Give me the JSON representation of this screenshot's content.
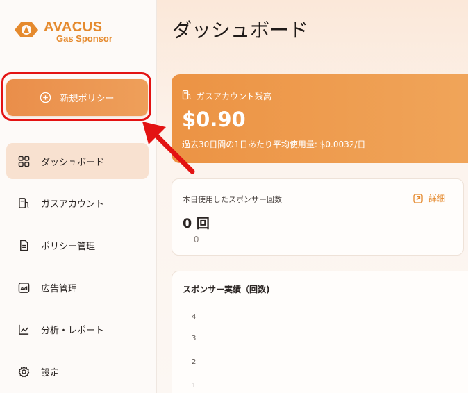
{
  "logo": {
    "title": "AVACUS",
    "subtitle": "Gas Sponsor"
  },
  "sidebar": {
    "new_policy_label": "新規ポリシー",
    "items": [
      {
        "label": "ダッシュボード",
        "icon": "grid-icon"
      },
      {
        "label": "ガスアカウント",
        "icon": "gas-pump-icon"
      },
      {
        "label": "ポリシー管理",
        "icon": "document-icon"
      },
      {
        "label": "広告管理",
        "icon": "ad-icon"
      },
      {
        "label": "分析・レポート",
        "icon": "chart-icon"
      },
      {
        "label": "設定",
        "icon": "gear-icon"
      }
    ]
  },
  "main": {
    "title": "ダッシュボード",
    "balance": {
      "label": "ガスアカウント残高",
      "value": "$0.90",
      "note": "過去30日間の1日あたり平均使用量: $0.0032/日"
    },
    "today": {
      "label": "本日使用したスポンサー回数",
      "detail_label": "詳細",
      "value": "0 回",
      "delta": "— 0"
    },
    "performance": {
      "title": "スポンサー実績（回数)",
      "y_ticks": [
        "4",
        "3",
        "2",
        "1"
      ]
    }
  },
  "colors": {
    "accent": "#e58a2e",
    "highlight": "#e31313",
    "active_bg": "#f8e1d0"
  }
}
